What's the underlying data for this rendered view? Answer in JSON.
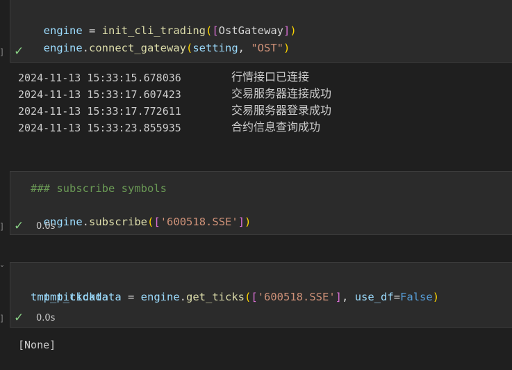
{
  "cell1": {
    "line1": {
      "a": "engine",
      "b": " = ",
      "c": "init_cli_trading",
      "d": "(",
      "e": "[",
      "f": "OstGateway",
      "g": "]",
      "h": ")"
    },
    "line2": {
      "a": "engine",
      "b": ".",
      "c": "connect_gateway",
      "d": "(",
      "e": "setting",
      "f": ", ",
      "g": "\"OST\"",
      "h": ")"
    },
    "marker": "]"
  },
  "output1": {
    "rows": [
      {
        "time": "2024-11-13 15:33:15.678036",
        "msg": "行情接口已连接"
      },
      {
        "time": "2024-11-13 15:33:17.607423",
        "msg": "交易服务器连接成功"
      },
      {
        "time": "2024-11-13 15:33:17.772611",
        "msg": "交易服务器登录成功"
      },
      {
        "time": "2024-11-13 15:33:23.855935",
        "msg": "合约信息查询成功"
      }
    ]
  },
  "cell2": {
    "comment": "### subscribe symbols",
    "line2": {
      "a": "engine",
      "b": ".",
      "c": "subscribe",
      "d": "(",
      "e": "[",
      "f": "'600518.SSE'",
      "g": "]",
      "h": ")"
    },
    "time": "0.0s",
    "marker": "]"
  },
  "cell3": {
    "line1": {
      "a": "tmp_tickdata",
      "b": " = ",
      "c": "engine",
      "d": ".",
      "e": "get_ticks",
      "f": "(",
      "g": "[",
      "h": "'600518.SSE'",
      "i": "]",
      "j": ", ",
      "k": "use_df",
      "l": "=",
      "m": "False",
      "n": ")"
    },
    "line2": "tmp_tickdata",
    "time": "0.0s",
    "marker": "]",
    "chevron": "˅"
  },
  "output3": {
    "text": "[None]"
  },
  "icons": {
    "check": "check-icon"
  }
}
